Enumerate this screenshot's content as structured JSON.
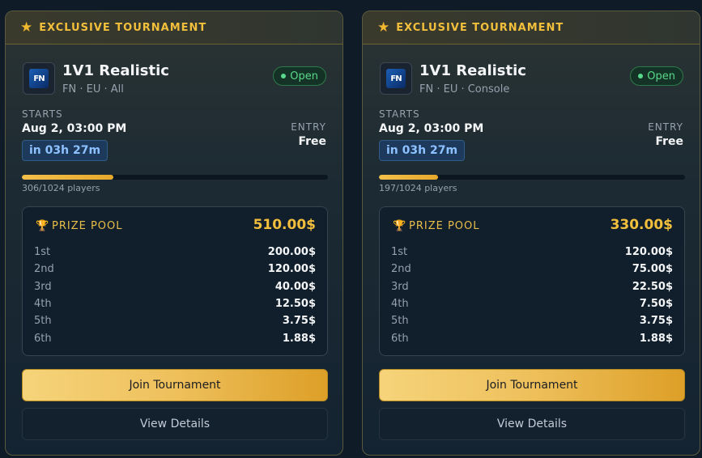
{
  "cards": [
    {
      "banner": "EXCLUSIVE TOURNAMENT",
      "logo_text": "FN",
      "title": "1V1 Realistic",
      "subtitle": "FN · EU · All",
      "status": "Open",
      "starts_label": "STARTS",
      "starts_value": "Aug 2, 03:00 PM",
      "countdown": "in 03h 27m",
      "entry_label": "ENTRY",
      "entry_value": "Free",
      "players_text": "306/1024 players",
      "players_fraction": 0.299,
      "prize_label": "PRIZE POOL",
      "prize_total": "510.00$",
      "prizes": [
        {
          "place": "1st",
          "amount": "200.00$"
        },
        {
          "place": "2nd",
          "amount": "120.00$"
        },
        {
          "place": "3rd",
          "amount": "40.00$"
        },
        {
          "place": "4th",
          "amount": "12.50$"
        },
        {
          "place": "5th",
          "amount": "3.75$"
        },
        {
          "place": "6th",
          "amount": "1.88$"
        }
      ],
      "join_label": "Join Tournament",
      "details_label": "View Details"
    },
    {
      "banner": "EXCLUSIVE TOURNAMENT",
      "logo_text": "FN",
      "title": "1V1 Realistic",
      "subtitle": "FN · EU · Console",
      "status": "Open",
      "starts_label": "STARTS",
      "starts_value": "Aug 2, 03:00 PM",
      "countdown": "in 03h 27m",
      "entry_label": "ENTRY",
      "entry_value": "Free",
      "players_text": "197/1024 players",
      "players_fraction": 0.192,
      "prize_label": "PRIZE POOL",
      "prize_total": "330.00$",
      "prizes": [
        {
          "place": "1st",
          "amount": "120.00$"
        },
        {
          "place": "2nd",
          "amount": "75.00$"
        },
        {
          "place": "3rd",
          "amount": "22.50$"
        },
        {
          "place": "4th",
          "amount": "7.50$"
        },
        {
          "place": "5th",
          "amount": "3.75$"
        },
        {
          "place": "6th",
          "amount": "1.88$"
        }
      ],
      "join_label": "Join Tournament",
      "details_label": "View Details"
    }
  ],
  "icons": {
    "banner": "star-icon",
    "prize": "trophy-icon",
    "status": "status-dot-icon"
  },
  "colors": {
    "accent_gold": "#f2bf3c",
    "open_green": "#59d98b",
    "countdown_blue": "#8dc1ff"
  }
}
